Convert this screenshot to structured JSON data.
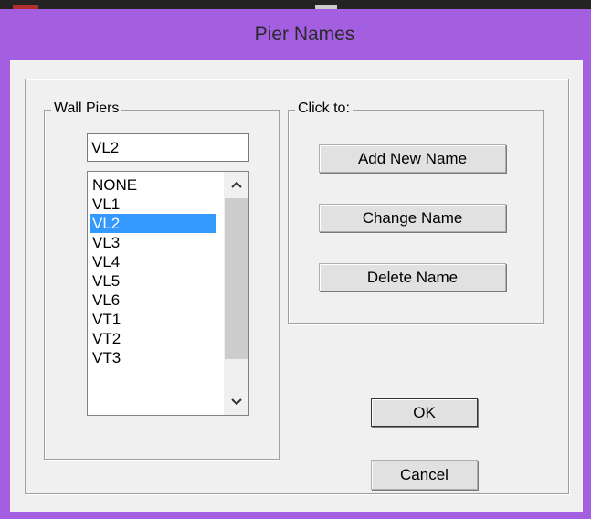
{
  "window": {
    "title": "Pier Names"
  },
  "wall_piers": {
    "group_label": "Wall Piers",
    "current_value": "VL2",
    "items": [
      "NONE",
      "VL1",
      "VL2",
      "VL3",
      "VL4",
      "VL5",
      "VL6",
      "VT1",
      "VT2",
      "VT3"
    ],
    "selected_index": 2
  },
  "click_to": {
    "group_label": "Click to:",
    "add_label": "Add New Name",
    "change_label": "Change Name",
    "delete_label": "Delete Name"
  },
  "actions": {
    "ok_label": "OK",
    "cancel_label": "Cancel"
  },
  "icons": {
    "scroll_up": "chevron-up-icon",
    "scroll_down": "chevron-down-icon"
  },
  "colors": {
    "titlebar": "#a45fe0",
    "selection": "#3399ff",
    "client": "#f0f0f0"
  }
}
